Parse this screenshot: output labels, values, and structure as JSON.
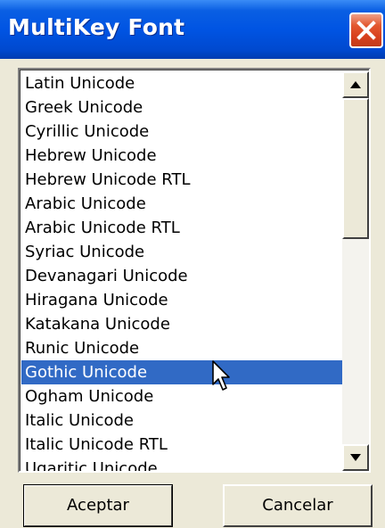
{
  "window": {
    "title": "MultiKey Font"
  },
  "list": {
    "items": [
      "Latin Unicode",
      "Greek Unicode",
      "Cyrillic Unicode",
      "Hebrew Unicode",
      "Hebrew Unicode RTL",
      "Arabic Unicode",
      "Arabic Unicode RTL",
      "Syriac Unicode",
      "Devanagari Unicode",
      "Hiragana Unicode",
      "Katakana Unicode",
      "Runic Unicode",
      "Gothic Unicode",
      "Ogham Unicode",
      "Italic Unicode",
      "Italic Unicode RTL",
      "Ugaritic Unicode"
    ],
    "selected_index": 12,
    "selected_value": "Gothic Unicode"
  },
  "buttons": {
    "ok_label": "Aceptar",
    "cancel_label": "Cancelar"
  },
  "icons": {
    "close": "close-icon",
    "scroll_up": "arrow-up-icon",
    "scroll_down": "arrow-down-icon",
    "cursor": "mouse-pointer-icon"
  },
  "colors": {
    "titlebar": "#0054e3",
    "selection": "#316ac5",
    "close_button": "#d8401d",
    "dialog_background": "#ece9d8"
  }
}
